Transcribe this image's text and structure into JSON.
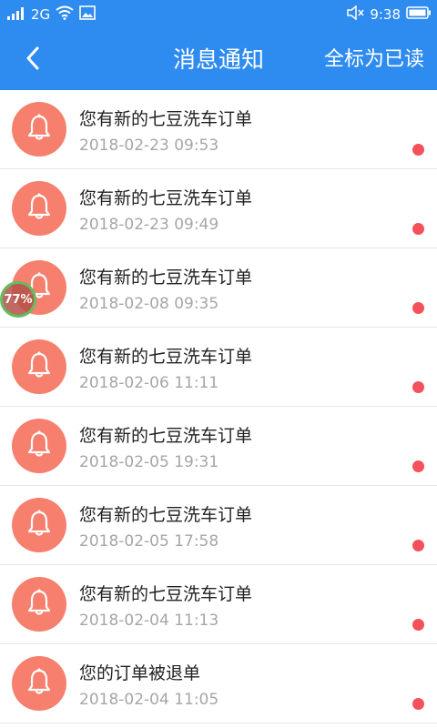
{
  "status_bar": {
    "network": "2G",
    "time": "9:38",
    "icons": [
      "signal-icon",
      "wifi-icon",
      "image-icon",
      "mute-icon",
      "battery-icon"
    ]
  },
  "nav": {
    "title": "消息通知",
    "mark_all_read": "全标为已读",
    "back_icon": "chevron-left-icon"
  },
  "colors": {
    "primary": "#2e8bf0",
    "avatar_bg": "#f77f6d",
    "unread_dot": "#f4515a"
  },
  "overlay": {
    "progress": "77%"
  },
  "notifications": [
    {
      "title": "您有新的七豆洗车订单",
      "time": "2018-02-23 09:53",
      "unread": true
    },
    {
      "title": "您有新的七豆洗车订单",
      "time": "2018-02-23 09:49",
      "unread": true
    },
    {
      "title": "您有新的七豆洗车订单",
      "time": "2018-02-08 09:35",
      "unread": true
    },
    {
      "title": "您有新的七豆洗车订单",
      "time": "2018-02-06 11:11",
      "unread": true
    },
    {
      "title": "您有新的七豆洗车订单",
      "time": "2018-02-05 19:31",
      "unread": true
    },
    {
      "title": "您有新的七豆洗车订单",
      "time": "2018-02-05 17:58",
      "unread": true
    },
    {
      "title": "您有新的七豆洗车订单",
      "time": "2018-02-04 11:13",
      "unread": true
    },
    {
      "title": "您的订单被退单",
      "time": "2018-02-04 11:05",
      "unread": true
    }
  ]
}
